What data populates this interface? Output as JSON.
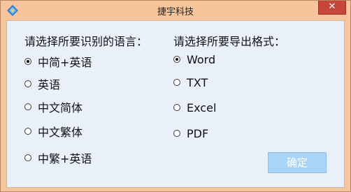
{
  "window": {
    "title": "捷宇科技",
    "close_symbol": "✕"
  },
  "icons": {
    "app": "app-logo-icon",
    "close": "close-icon"
  },
  "language_group": {
    "title": "请选择所要识别的语言：",
    "selected": "中简+英语",
    "options": [
      "中简+英语",
      "英语",
      "中文简体",
      "中文繁体",
      "中繁+英语"
    ]
  },
  "format_group": {
    "title": "请选择所要导出格式：",
    "selected": "Word",
    "options": [
      "Word",
      "TXT",
      "Excel",
      "PDF"
    ]
  },
  "ok_button": {
    "label": "确定"
  },
  "colors": {
    "frame": "#f6c59c",
    "client": "#e9f0fa",
    "close": "#c7463a",
    "ok_button": "#a9d4f7"
  }
}
